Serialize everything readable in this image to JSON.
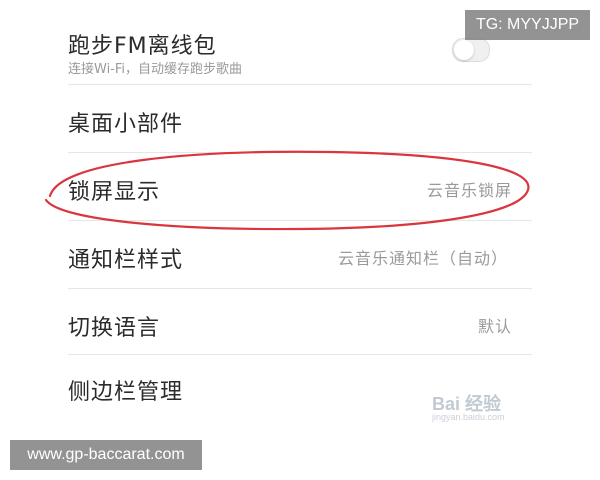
{
  "settings": {
    "rows": [
      {
        "label": "跑步FM离线包",
        "subtitle": "连接Wi-Fi，自动缓存跑步歌曲",
        "value": ""
      },
      {
        "label": "桌面小部件",
        "value": ""
      },
      {
        "label": "锁屏显示",
        "value": "云音乐锁屏"
      },
      {
        "label": "通知栏样式",
        "value": "云音乐通知栏（自动）"
      },
      {
        "label": "切换语言",
        "value": "默认"
      },
      {
        "label": "侧边栏管理",
        "value": ""
      }
    ]
  },
  "overlay": {
    "top_tag": "TG: MYYJJPP",
    "bottom_tag": "www.gp-baccarat.com",
    "watermark": "Bai 经验",
    "watermark_sub": "jingyan.baidu.com"
  },
  "colors": {
    "highlight_ellipse": "#d9363e",
    "divider": "#e6e6e6",
    "secondary_text": "#9a9a9a"
  }
}
